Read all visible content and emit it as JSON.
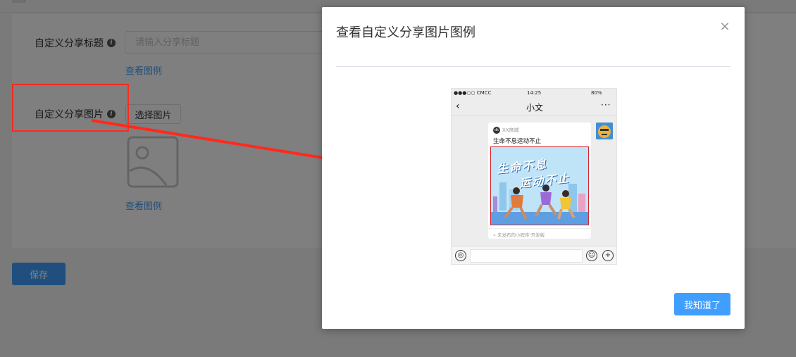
{
  "form": {
    "title_label": "自定义分享标题",
    "title_placeholder": "请输入分享标题",
    "title_value": "",
    "view_example_1": "查看图例",
    "image_label": "自定义分享图片",
    "choose_image": "选择图片",
    "view_example_2": "查看图例",
    "save": "保存"
  },
  "dialog": {
    "title": "查看自定义分享图片图例",
    "close_symbol": "×",
    "ok": "我知道了"
  },
  "phone": {
    "status": {
      "carrier": "●●●○○ CMCC",
      "time": "14:25",
      "battery": "80%"
    },
    "nav": {
      "back": "‹",
      "title": "小文",
      "more": "···"
    },
    "card": {
      "brand": "XX商城",
      "brand_logo": "dk",
      "title": "生命不息运动不止",
      "poster_line1": "生命不息",
      "poster_line2": "运动不止",
      "footer": "未发布的小程序·开发版"
    }
  },
  "icons": {
    "info": "i",
    "voice": "◎",
    "emoji": "☺",
    "plus": "+",
    "link": "⌁"
  },
  "colors": {
    "primary": "#409eff",
    "annotation": "#ff2a1d",
    "poster_border": "#d7232c"
  }
}
